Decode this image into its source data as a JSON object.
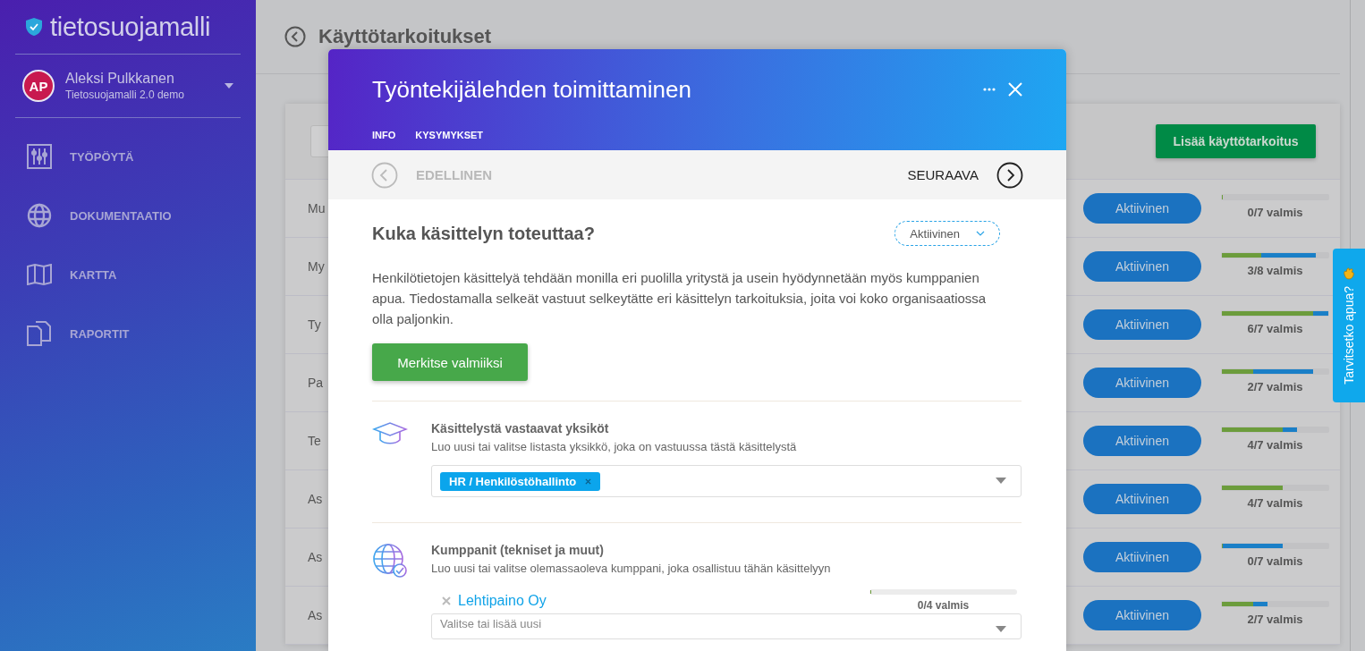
{
  "sidebar": {
    "logo": "tietosuojamalli",
    "user": {
      "initials": "AP",
      "name": "Aleksi Pulkkanen",
      "organization": "Tietosuojamalli 2.0 demo"
    },
    "items": [
      {
        "label": "TYÖPÖYTÄ",
        "kind": "dashboard",
        "selected": false
      },
      {
        "label": "DOKUMENTAATIO",
        "kind": "documentation",
        "selected": false
      },
      {
        "label": "KARTTA",
        "kind": "map",
        "selected": false
      },
      {
        "label": "RAPORTIT",
        "kind": "reports",
        "selected": false
      }
    ]
  },
  "page": {
    "title": "Käyttötarkoitukset",
    "add_button": "Lisää käyttötarkoitus",
    "rows": [
      {
        "name": "Mu",
        "status": "Aktiivinen",
        "progress": {
          "level": 0
        },
        "in_progress": {
          "level": 0
        },
        "reading": "0/7 valmis"
      },
      {
        "name": "My",
        "status": "Aktiivinen",
        "progress": {
          "level": 0.37
        },
        "in_progress": {
          "level": 0.88
        },
        "reading": "3/8 valmis"
      },
      {
        "name": "Ty",
        "status": "Aktiivinen",
        "progress": {
          "level": 0.86
        },
        "in_progress": {
          "level": 1
        },
        "reading": "6/7 valmis"
      },
      {
        "name": "Pa",
        "status": "Aktiivinen",
        "progress": {
          "level": 0.29
        },
        "in_progress": {
          "level": 0.86
        },
        "reading": "2/7 valmis"
      },
      {
        "name": "Te",
        "status": "Aktiivinen",
        "progress": {
          "level": 0.57
        },
        "in_progress": {
          "level": 0.71
        },
        "reading": "4/7 valmis"
      },
      {
        "name": "As",
        "status": "Aktiivinen",
        "progress": {
          "level": 0.57
        },
        "in_progress": {
          "level": 0
        },
        "reading": "4/7 valmis"
      },
      {
        "name": "As",
        "status": "Aktiivinen",
        "progress": {
          "level": 0
        },
        "in_progress": {
          "level": 0.57
        },
        "reading": "0/7 valmis"
      },
      {
        "name": "As",
        "status": "Aktiivinen",
        "progress": {
          "level": 0.29
        },
        "in_progress": {
          "level": 0.43
        },
        "reading": "2/7 valmis"
      }
    ]
  },
  "help_tab": {
    "label": "Tarvitsetko apua?"
  },
  "modal": {
    "title": "Työntekijälehden toimittaminen",
    "tabs": [
      {
        "label": "INFO",
        "selected": false
      },
      {
        "label": "KYSYMYKSET",
        "selected": false
      }
    ],
    "previous": {
      "label": "EDELLINEN",
      "disabled": true
    },
    "next": {
      "label": "SEURAAVA",
      "disabled": false
    },
    "question": {
      "heading": "Kuka käsittelyn toteuttaa?",
      "status": "Aktiivinen",
      "description": "Henkilötietojen käsittelyä tehdään monilla eri puolilla yritystä ja usein hyödynnetään myös kumppanien apua. Tiedostamalla selkeät vastuut selkeytätte eri käsittelyn tarkoituksia, joita voi koko organisaatiossa olla paljonkin.",
      "mark_done_button": "Merkitse valmiiksi"
    },
    "sections": [
      {
        "kind": "units",
        "title": "Käsittelystä vastaavat yksiköt",
        "hint": "Luo uusi tai valitse listasta yksikkö, joka on vastuussa tästä käsittelystä",
        "tags": [
          "HR / Henkilöstöhallinto"
        ]
      },
      {
        "kind": "partners",
        "title": "Kumppanit (tekniset ja muut)",
        "hint": "Luo uusi tai valitse olemassaoleva kumppani, joka osallistuu tähän käsittelyyn",
        "partners": [
          {
            "name": "Lehtipaino Oy",
            "progress": {
              "level": 0
            },
            "reading": "0/4 valmis"
          }
        ],
        "placeholder": "Valitse tai lisää uusi"
      }
    ]
  }
}
